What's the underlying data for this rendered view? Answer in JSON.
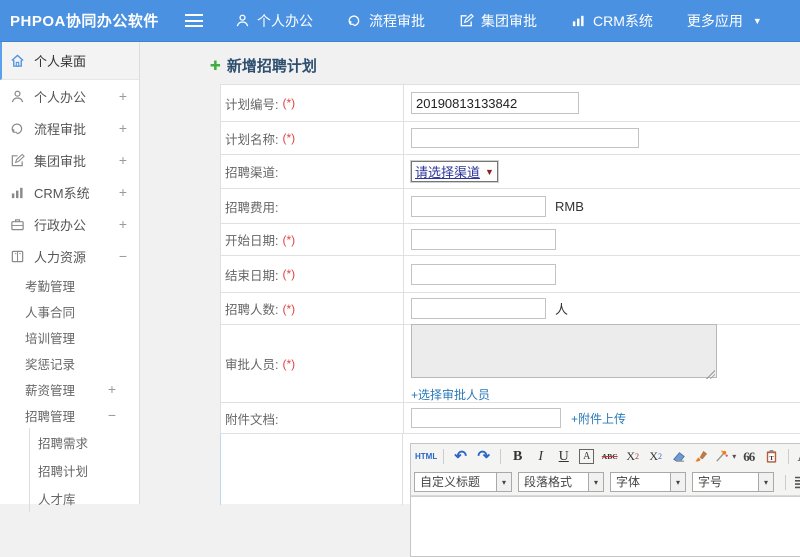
{
  "header": {
    "brand": "PHPOA协同办公软件",
    "menu": [
      {
        "label": "个人办公",
        "icon": "user"
      },
      {
        "label": "流程审批",
        "icon": "flow"
      },
      {
        "label": "集团审批",
        "icon": "edit"
      },
      {
        "label": "CRM系统",
        "icon": "chart"
      }
    ],
    "more_label": "更多应用"
  },
  "sidebar": {
    "items": [
      {
        "label": "个人桌面",
        "icon": "home",
        "active": true
      },
      {
        "label": "个人办公",
        "icon": "user",
        "expander": "+"
      },
      {
        "label": "流程审批",
        "icon": "flow",
        "expander": "+"
      },
      {
        "label": "集团审批",
        "icon": "edit",
        "expander": "+"
      },
      {
        "label": "CRM系统",
        "icon": "chart",
        "expander": "+"
      },
      {
        "label": "行政办公",
        "icon": "briefcase",
        "expander": "+"
      },
      {
        "label": "人力资源",
        "icon": "book",
        "expander": "−"
      }
    ],
    "hr_sub": [
      {
        "label": "考勤管理"
      },
      {
        "label": "人事合同"
      },
      {
        "label": "培训管理"
      },
      {
        "label": "奖惩记录"
      },
      {
        "label": "薪资管理",
        "expander": "+"
      },
      {
        "label": "招聘管理",
        "expander": "−"
      }
    ],
    "recruit_sub": [
      {
        "label": "招聘需求"
      },
      {
        "label": "招聘计划"
      },
      {
        "label": "人才库"
      }
    ]
  },
  "main": {
    "title": "新增招聘计划",
    "form": {
      "plan_no": {
        "label": "计划编号:",
        "required": "(*)",
        "value": "20190813133842"
      },
      "plan_name": {
        "label": "计划名称:",
        "required": "(*)"
      },
      "channel": {
        "label": "招聘渠道:",
        "select_text": "请选择渠道"
      },
      "fee": {
        "label": "招聘费用:",
        "suffix": "RMB"
      },
      "start_date": {
        "label": "开始日期:",
        "required": "(*)"
      },
      "end_date": {
        "label": "结束日期:",
        "required": "(*)"
      },
      "headcount": {
        "label": "招聘人数:",
        "required": "(*)",
        "suffix": "人"
      },
      "approver": {
        "label": "审批人员:",
        "required": "(*)",
        "link": "+选择审批人员"
      },
      "attachment": {
        "label": "附件文档:",
        "link": "+附件上传"
      }
    },
    "editor": {
      "html": "HTML",
      "bold": "B",
      "italic": "I",
      "underline": "U",
      "autotypeset": "A",
      "strikethrough": "ABC",
      "quote": "66",
      "fontcolor": "A",
      "bgcolor": "ab",
      "dropdowns": {
        "style": "自定义标题",
        "format": "段落格式",
        "font": "字体",
        "size": "字号"
      }
    }
  },
  "colors": {
    "header_blue": "#4b91e2",
    "accent_green": "#3fae3f",
    "link_blue": "#2a7ab8",
    "required_red": "#e04343",
    "title_navy": "#2e4e6e"
  }
}
